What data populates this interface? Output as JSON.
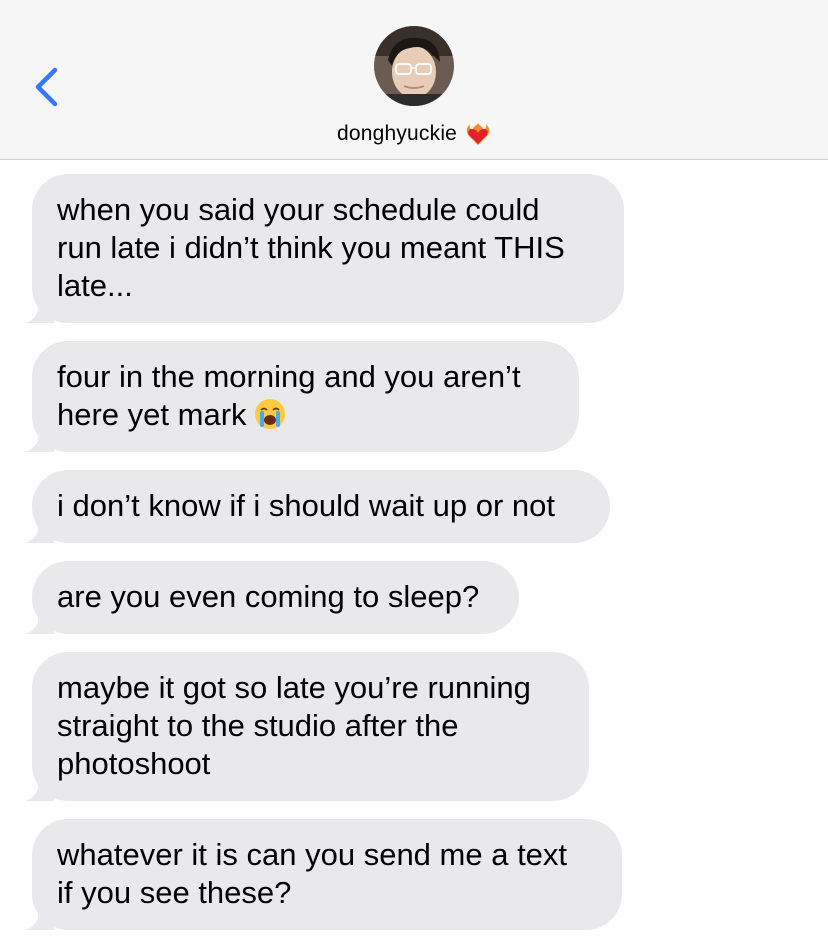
{
  "header": {
    "contact_name": "donghyuckie",
    "contact_emoji": "heart-on-fire-emoji",
    "back_icon": "chevron-left-icon",
    "accent_color": "#3478f6"
  },
  "messages": [
    {
      "lines": [
        "when you said your schedule could",
        "run late i didn’t think you meant THIS",
        "late..."
      ]
    },
    {
      "lines": [
        "four in the morning and you aren’t",
        "here yet mark"
      ],
      "trailing_emoji": "loudly-crying-face-emoji"
    },
    {
      "lines": [
        "i don’t know if i should wait up or not"
      ]
    },
    {
      "lines": [
        "are you even coming to sleep?"
      ]
    },
    {
      "lines": [
        "maybe it got so late you’re running",
        "straight to the studio after the",
        "photoshoot"
      ]
    },
    {
      "lines": [
        "whatever it is can you send me a text",
        "if you see these?"
      ]
    }
  ],
  "colors": {
    "incoming_bubble": "#e9e9eb",
    "header_background": "#f6f6f6"
  }
}
